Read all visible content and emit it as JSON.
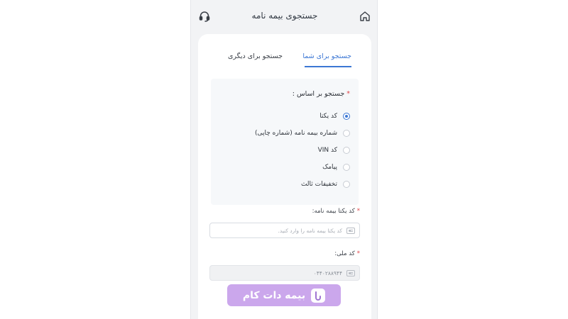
{
  "header": {
    "title": "جستجوی بیمه نامه",
    "home_icon": "home-icon",
    "support_icon": "headset-icon"
  },
  "tabs": [
    {
      "label": "جستجو برای شما",
      "active": true
    },
    {
      "label": "جستجو برای دیگری",
      "active": false
    }
  ],
  "search_by": {
    "label": "جستجو بر اساس :",
    "required_mark": "*",
    "options": [
      {
        "label": "کد یکتا",
        "checked": true
      },
      {
        "label": "شماره بیمه نامه (شماره چاپی)",
        "checked": false
      },
      {
        "label": "کد VIN",
        "checked": false
      },
      {
        "label": "پیامک",
        "checked": false
      },
      {
        "label": "تخفیفات ثالث",
        "checked": false
      }
    ]
  },
  "unique_code_field": {
    "label": "کد یکتا بیمه نامه:",
    "required_mark": "*",
    "value": "",
    "placeholder": "کد یکتا بیمه نامه را وارد کنید."
  },
  "national_code_field": {
    "label": "کد ملی:",
    "required_mark": "*",
    "value": "۰۴۴۰۲۸۸۹۴۴"
  },
  "watermark": {
    "text": "بیمه دات کام",
    "logo_icon": "bimeh-logo-icon"
  },
  "colors": {
    "accent": "#3c77d4",
    "required": "#e0464a",
    "watermark_bg": "#c9a3ec"
  }
}
